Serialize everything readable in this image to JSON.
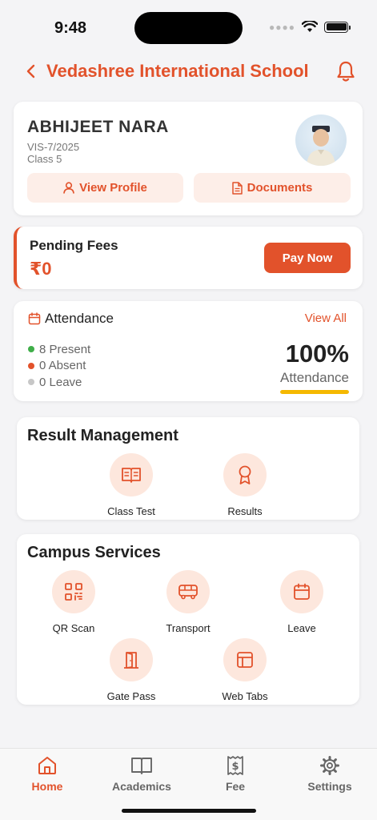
{
  "status_bar": {
    "time": "9:48"
  },
  "header": {
    "title": "Vedashree International School"
  },
  "profile": {
    "name": "ABHIJEET NARA",
    "id": "VIS-7/2025",
    "class": "Class 5",
    "view_profile_label": "View Profile",
    "documents_label": "Documents"
  },
  "fees": {
    "title": "Pending Fees",
    "amount": "₹0",
    "pay_label": "Pay Now"
  },
  "attendance": {
    "title": "Attendance",
    "view_all_label": "View All",
    "present": "8 Present",
    "absent": "0 Absent",
    "leave": "0 Leave",
    "percent": "100%",
    "caption": "Attendance",
    "progress_fraction": 1.0,
    "colors": {
      "present": "#3fae49",
      "absent": "#e2522b",
      "leave": "#c7c7c7",
      "bar": "#f5b800"
    }
  },
  "result_management": {
    "title": "Result Management",
    "items": [
      {
        "label": "Class Test",
        "icon": "book-open-icon"
      },
      {
        "label": "Results",
        "icon": "award-icon"
      }
    ]
  },
  "campus_services": {
    "title": "Campus Services",
    "items": [
      {
        "label": "QR Scan",
        "icon": "qr-code-icon"
      },
      {
        "label": "Transport",
        "icon": "bus-icon"
      },
      {
        "label": "Leave",
        "icon": "calendar-icon"
      },
      {
        "label": "Gate Pass",
        "icon": "door-icon"
      },
      {
        "label": "Web Tabs",
        "icon": "layout-icon"
      }
    ]
  },
  "bottom_nav": {
    "items": [
      {
        "label": "Home",
        "icon": "home-icon",
        "active": true
      },
      {
        "label": "Academics",
        "icon": "book-icon",
        "active": false
      },
      {
        "label": "Fee",
        "icon": "receipt-dollar-icon",
        "active": false
      },
      {
        "label": "Settings",
        "icon": "gear-icon",
        "active": false
      }
    ]
  },
  "theme": {
    "accent": "#e2522b",
    "accent_light": "#fde7dd"
  }
}
